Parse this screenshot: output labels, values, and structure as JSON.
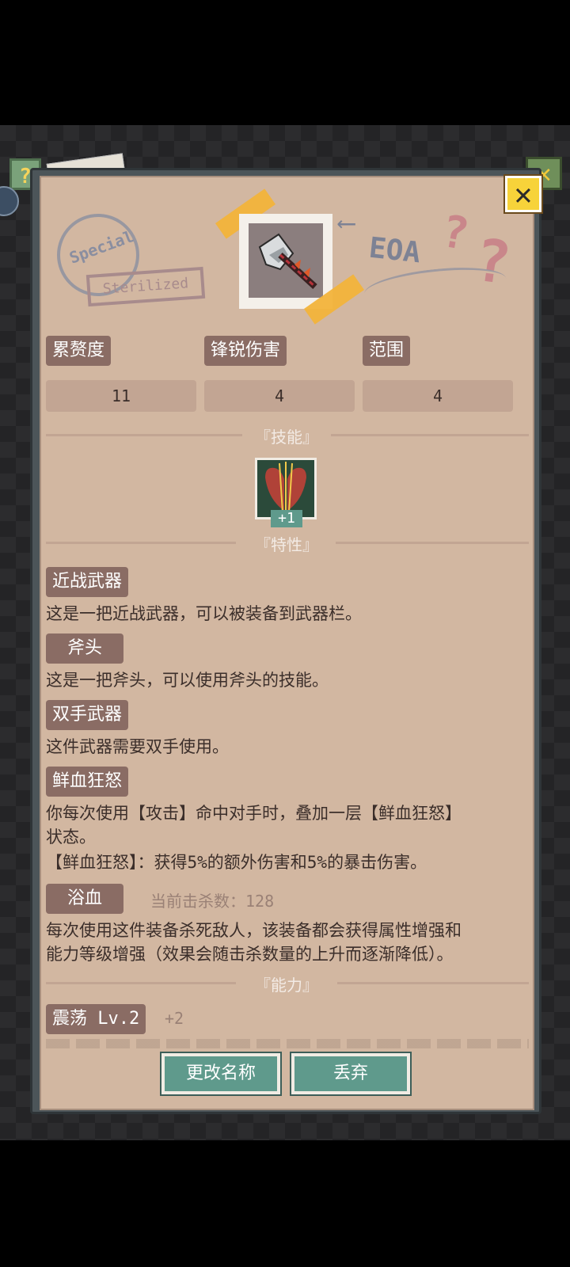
{
  "stats": {
    "labels": [
      "累赘度",
      "锋锐伤害",
      "范围"
    ],
    "values": [
      "11",
      "4",
      "4"
    ]
  },
  "sections": {
    "skills": "『技能』",
    "traits": "『特性』",
    "abilities": "『能力』"
  },
  "skill": {
    "plus": "+1"
  },
  "traits": [
    {
      "tag": "近战武器",
      "desc": "这是一把近战武器，可以被装备到武器栏。"
    },
    {
      "tag": "斧头",
      "desc": "这是一把斧头，可以使用斧头的技能。"
    },
    {
      "tag": "双手武器",
      "desc": "这件武器需要双手使用。"
    },
    {
      "tag": "鲜血狂怒",
      "desc1": "你每次使用【攻击】命中对手时，叠加一层【鲜血狂怒】",
      "desc2": "状态。",
      "desc3": "【鲜血狂怒】：获得5%的额外伤害和5%的暴击伤害。"
    },
    {
      "tag": "浴血",
      "extra": "当前击杀数：128",
      "desc1": "每次使用这件装备杀死敌人，该装备都会获得属性增强和",
      "desc2": "能力等级增强（效果会随击杀数量的上升而逐渐降低）。"
    }
  ],
  "ability": {
    "name": "震荡 Lv.2",
    "bonus": "+2"
  },
  "buttons": {
    "rename": "更改名称",
    "discard": "丢弃"
  },
  "decor": {
    "stamp_circle": "Special",
    "stamp_rect": "Sterilized",
    "scribble": "EOA",
    "help": "?",
    "close": "✕"
  }
}
